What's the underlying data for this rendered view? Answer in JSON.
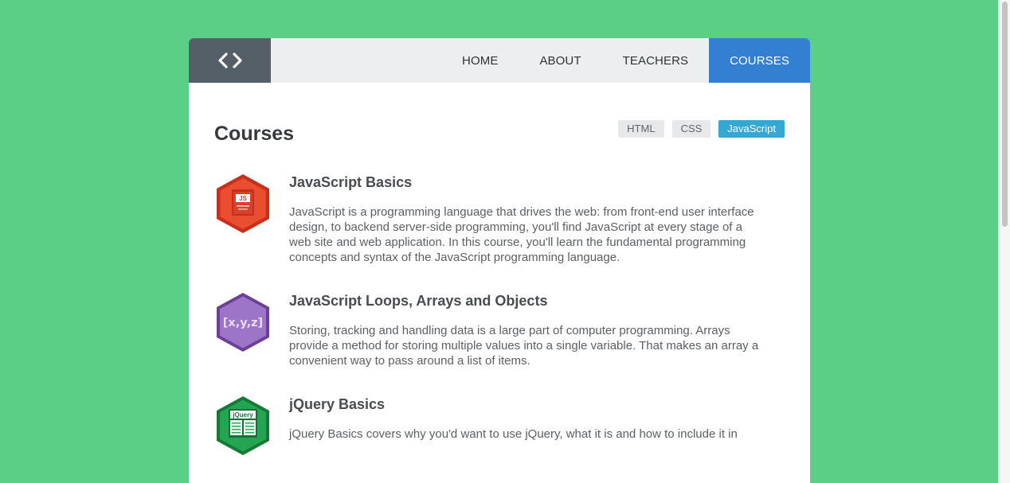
{
  "nav": {
    "logo_icon": "code-brackets-icon",
    "items": [
      {
        "label": "HOME",
        "active": false
      },
      {
        "label": "ABOUT",
        "active": false
      },
      {
        "label": "TEACHERS",
        "active": false
      },
      {
        "label": "COURSES",
        "active": true
      }
    ]
  },
  "main": {
    "title": "Courses",
    "filters": [
      {
        "label": "HTML",
        "active": false
      },
      {
        "label": "CSS",
        "active": false
      },
      {
        "label": "JavaScript",
        "active": true
      }
    ],
    "courses": [
      {
        "icon": "javascript-book-badge-icon",
        "icon_label": "JS",
        "title": "JavaScript Basics",
        "description": "JavaScript is a programming language that drives the web: from front-end user interface design, to backend server-side programming, you'll find JavaScript at every stage of a web site and web application. In this course, you'll learn the fundamental programming concepts and syntax of the JavaScript programming language."
      },
      {
        "icon": "xyz-array-badge-icon",
        "icon_label": "[x,y,z]",
        "title": "JavaScript Loops, Arrays and Objects",
        "description": "Storing, tracking and handling data is a large part of computer programming. Arrays provide a method for storing multiple values into a single variable. That makes an array a convenient way to pass around a list of items."
      },
      {
        "icon": "jquery-book-badge-icon",
        "icon_label": "jQuery",
        "title": "jQuery Basics",
        "description": "jQuery Basics covers why you'd want to use jQuery, what it is and how to include it in"
      }
    ]
  },
  "colors": {
    "background": "#5bcf85",
    "logo_bg": "#555f68",
    "nav_active": "#3380d2",
    "tag_active": "#34a7d2",
    "badge_js": "#e74c2e",
    "badge_arrays": "#9b6fc4",
    "badge_jquery": "#1f9a4a"
  }
}
